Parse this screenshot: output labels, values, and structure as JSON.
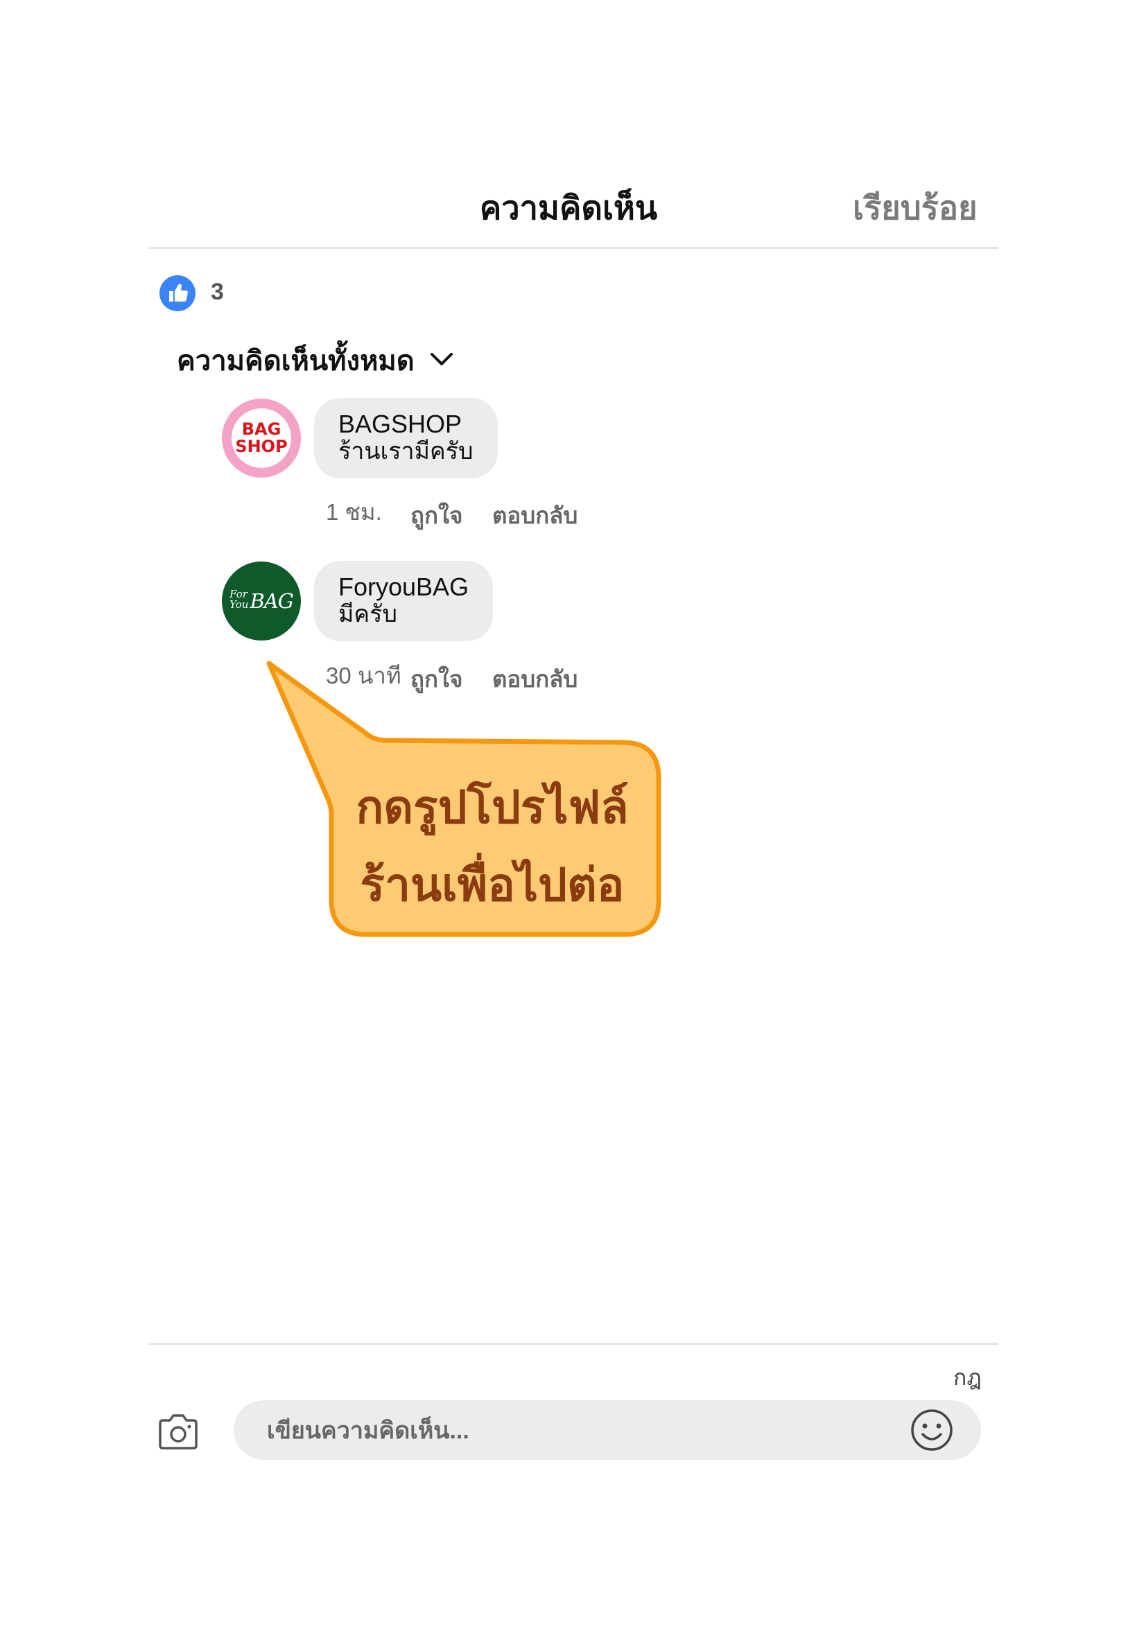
{
  "header": {
    "title": "ความคิดเห็น",
    "done_label": "เรียบร้อย"
  },
  "reactions": {
    "icon": "thumbs-up-icon",
    "count": "3",
    "accent_color": "#3b84f5"
  },
  "filter": {
    "label": "ความคิดเห็นทั้งหมด",
    "icon": "chevron-down-icon"
  },
  "comments": [
    {
      "avatar_text": [
        "BAG",
        "SHOP"
      ],
      "name": "BAGSHOP",
      "text": "ร้านเรามีครับ",
      "time": "1 ชม.",
      "like_label": "ถูกใจ",
      "reply_label": "ตอบกลับ"
    },
    {
      "avatar_text": [
        "For",
        "You",
        "BAG"
      ],
      "name": "ForyouBAG",
      "text": "มีครับ",
      "time": "30 นาที",
      "like_label": "ถูกใจ",
      "reply_label": "ตอบกลับ"
    }
  ],
  "callout": {
    "line1": "กดรูปโปรไฟล์",
    "line2": "ร้านเพื่อไปต่อ",
    "fill_color": "#fdcb73",
    "border_color": "#f5980f",
    "text_color": "#8a3b10"
  },
  "footer": {
    "rules_label": "กฎ",
    "camera_icon": "camera-icon",
    "input_placeholder": "เขียนความคิดเห็น...",
    "emoji_icon": "smiley-icon"
  }
}
